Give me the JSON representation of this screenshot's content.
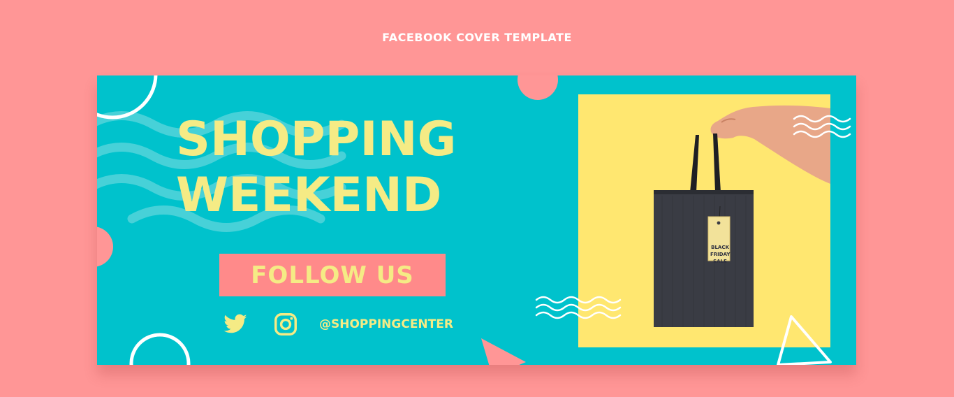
{
  "page": {
    "heading": "FACEBOOK COVER TEMPLATE"
  },
  "cover": {
    "headline_line1": "SHOPPING",
    "headline_line2": "WEEKEND",
    "follow_label": "FOLLOW US",
    "handle": "@SHOPPINGCENTER",
    "social_icons": [
      "twitter-icon",
      "instagram-icon"
    ],
    "tag_lines": [
      "BLACK",
      "FRIDAY",
      "SALE"
    ]
  },
  "colors": {
    "page_background": "#ff9696",
    "cover_background": "#00c2cc",
    "headline": "#f5eb85",
    "button_background": "#ff8a8a",
    "photo_background": "#ffe770",
    "bag": "#3a3c44"
  }
}
